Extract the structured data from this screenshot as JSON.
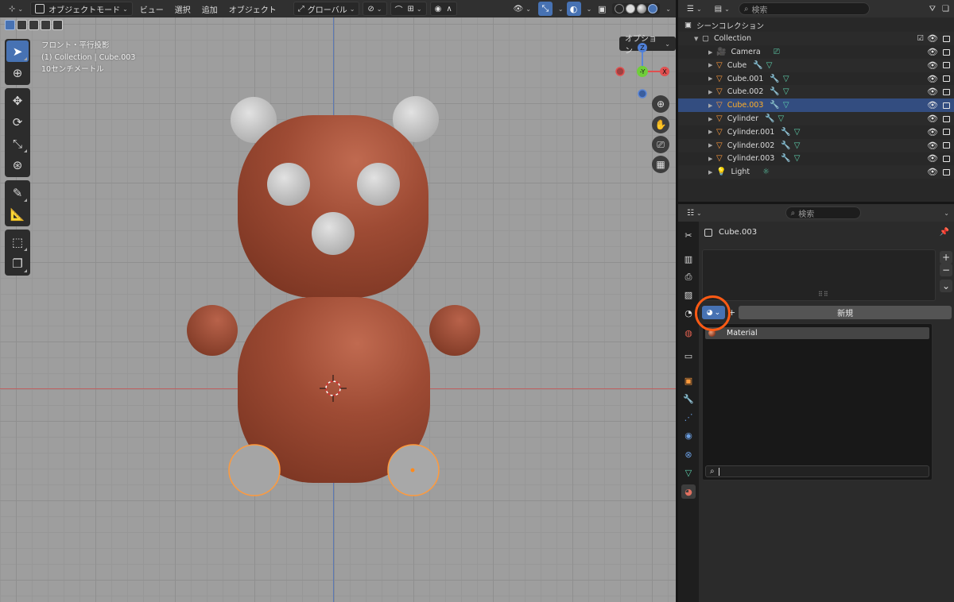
{
  "viewport_header": {
    "mode_label": "オブジェクトモード",
    "menu": [
      "ビュー",
      "選択",
      "追加",
      "オブジェクト"
    ],
    "transform_orientation": "グローバル"
  },
  "viewport": {
    "info_line1": "フロント・平行投影",
    "info_line2": "(1) Collection | Cube.003",
    "info_line3": "10センチメートル",
    "options_label": "オプション",
    "gizmo": {
      "z": "Z",
      "y": "-Y",
      "x": "X"
    }
  },
  "outliner": {
    "search_placeholder": "検索",
    "scene_collection": "シーンコレクション",
    "collection": "Collection",
    "items": [
      {
        "name": "Camera",
        "type": "camera"
      },
      {
        "name": "Cube",
        "type": "mesh"
      },
      {
        "name": "Cube.001",
        "type": "mesh"
      },
      {
        "name": "Cube.002",
        "type": "mesh"
      },
      {
        "name": "Cube.003",
        "type": "mesh",
        "selected": true
      },
      {
        "name": "Cylinder",
        "type": "mesh"
      },
      {
        "name": "Cylinder.001",
        "type": "mesh"
      },
      {
        "name": "Cylinder.002",
        "type": "mesh"
      },
      {
        "name": "Cylinder.003",
        "type": "mesh"
      },
      {
        "name": "Light",
        "type": "light"
      }
    ]
  },
  "properties": {
    "search_placeholder": "検索",
    "object_name": "Cube.003",
    "new_button": "新規",
    "material_list": [
      "Material"
    ]
  },
  "colors": {
    "accent_blue": "#4772b3",
    "selected_row": "#334d80",
    "active_object_text": "#ffaf29",
    "annotation_ring": "#ff5a14",
    "bear_body": "#9c4a34"
  }
}
